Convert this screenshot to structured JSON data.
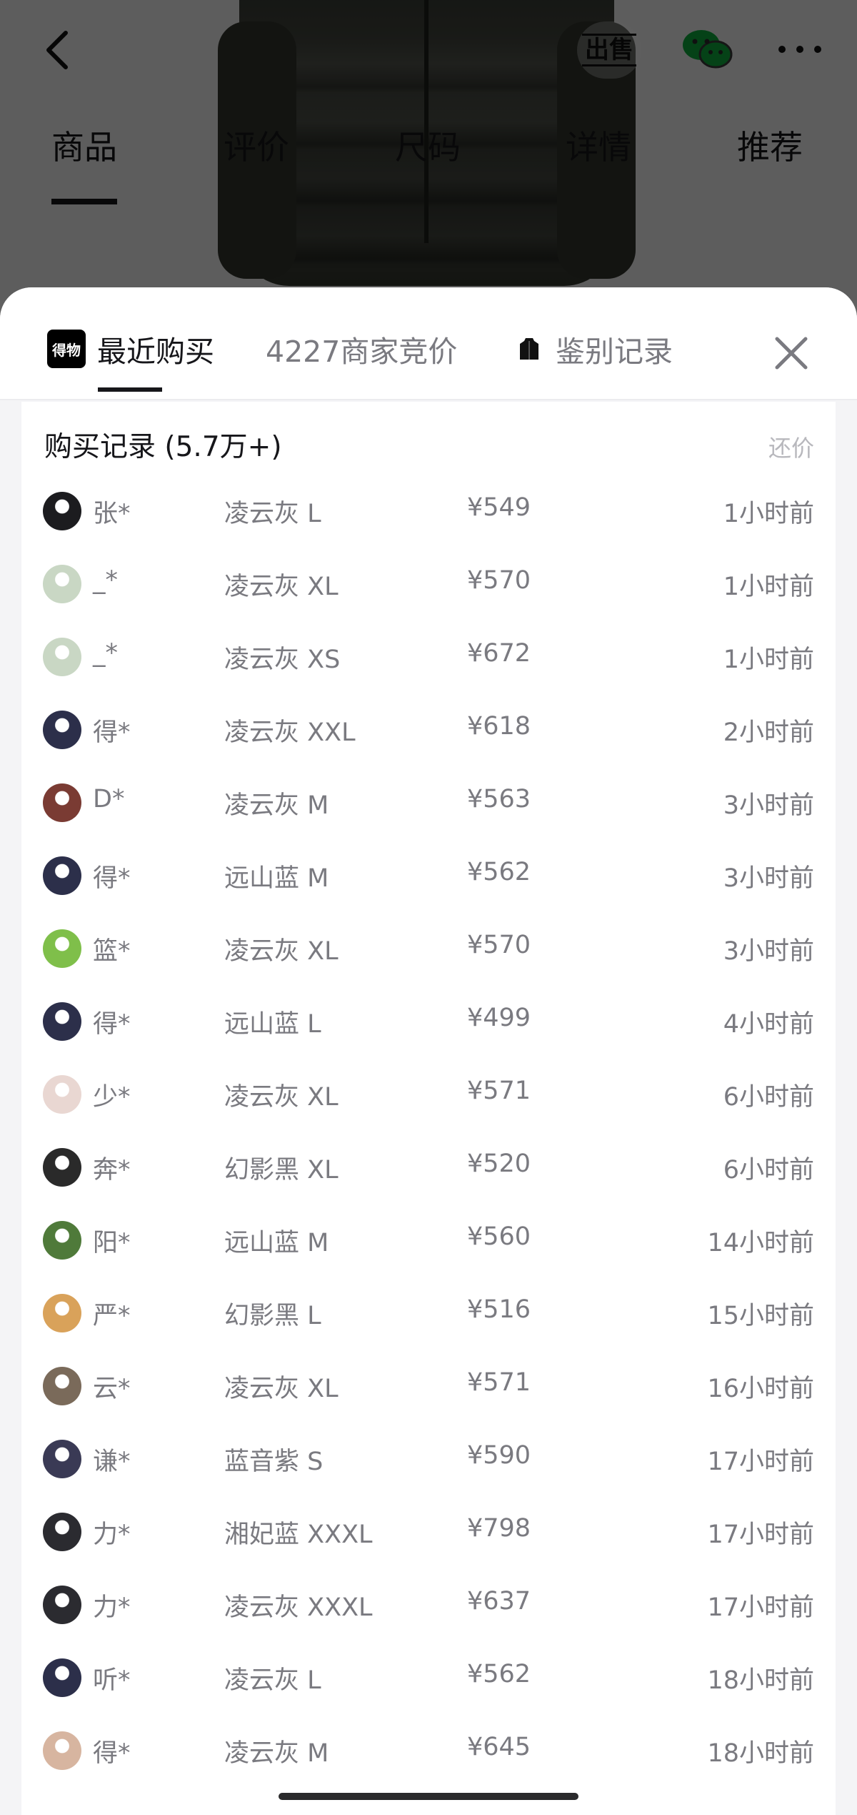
{
  "nav": {
    "sell_label": "出售",
    "tabs": [
      "商品",
      "评价",
      "尺码",
      "详情",
      "推荐"
    ]
  },
  "sheet": {
    "tabs": [
      {
        "label": "最近购买",
        "icon": "dewu-logo"
      },
      {
        "label": "4227商家竞价"
      },
      {
        "label": "鉴别记录",
        "icon": "jacket-icon"
      }
    ],
    "logo_text": "得物"
  },
  "records": {
    "title": "购买记录 (5.7万+)",
    "action": "还价",
    "rows": [
      {
        "name": "张*",
        "spec": "凌云灰 L",
        "price": "¥549",
        "time": "1小时前",
        "avatar": "#1c1c1f"
      },
      {
        "name": "_*",
        "spec": "凌云灰 XL",
        "price": "¥570",
        "time": "1小时前",
        "avatar": "#c9d7c4"
      },
      {
        "name": "_*",
        "spec": "凌云灰 XS",
        "price": "¥672",
        "time": "1小时前",
        "avatar": "#c9d7c4"
      },
      {
        "name": "得*",
        "spec": "凌云灰 XXL",
        "price": "¥618",
        "time": "2小时前",
        "avatar": "#2c2f4a"
      },
      {
        "name": "D*",
        "spec": "凌云灰 M",
        "price": "¥563",
        "time": "3小时前",
        "avatar": "#7a3b33"
      },
      {
        "name": "得*",
        "spec": "远山蓝 M",
        "price": "¥562",
        "time": "3小时前",
        "avatar": "#2c2f4a"
      },
      {
        "name": "篮*",
        "spec": "凌云灰 XL",
        "price": "¥570",
        "time": "3小时前",
        "avatar": "#7fbf4a"
      },
      {
        "name": "得*",
        "spec": "远山蓝 L",
        "price": "¥499",
        "time": "4小时前",
        "avatar": "#2c2f4a"
      },
      {
        "name": "少*",
        "spec": "凌云灰 XL",
        "price": "¥571",
        "time": "6小时前",
        "avatar": "#e9d7d2"
      },
      {
        "name": "奔*",
        "spec": "幻影黑 XL",
        "price": "¥520",
        "time": "6小时前",
        "avatar": "#2a2a2a"
      },
      {
        "name": "阳*",
        "spec": "远山蓝 M",
        "price": "¥560",
        "time": "14小时前",
        "avatar": "#4f7a3a"
      },
      {
        "name": "严*",
        "spec": "幻影黑 L",
        "price": "¥516",
        "time": "15小时前",
        "avatar": "#d9a25a"
      },
      {
        "name": "云*",
        "spec": "凌云灰 XL",
        "price": "¥571",
        "time": "16小时前",
        "avatar": "#7a6a5a"
      },
      {
        "name": "谦*",
        "spec": "蓝音紫 S",
        "price": "¥590",
        "time": "17小时前",
        "avatar": "#3a3a55"
      },
      {
        "name": "力*",
        "spec": "湘妃蓝 XXXL",
        "price": "¥798",
        "time": "17小时前",
        "avatar": "#2b2b30"
      },
      {
        "name": "力*",
        "spec": "凌云灰 XXXL",
        "price": "¥637",
        "time": "17小时前",
        "avatar": "#2b2b30"
      },
      {
        "name": "听*",
        "spec": "凌云灰 L",
        "price": "¥562",
        "time": "18小时前",
        "avatar": "#2c2f4a"
      },
      {
        "name": "得*",
        "spec": "凌云灰 M",
        "price": "¥645",
        "time": "18小时前",
        "avatar": "#d7b5a0"
      }
    ]
  }
}
